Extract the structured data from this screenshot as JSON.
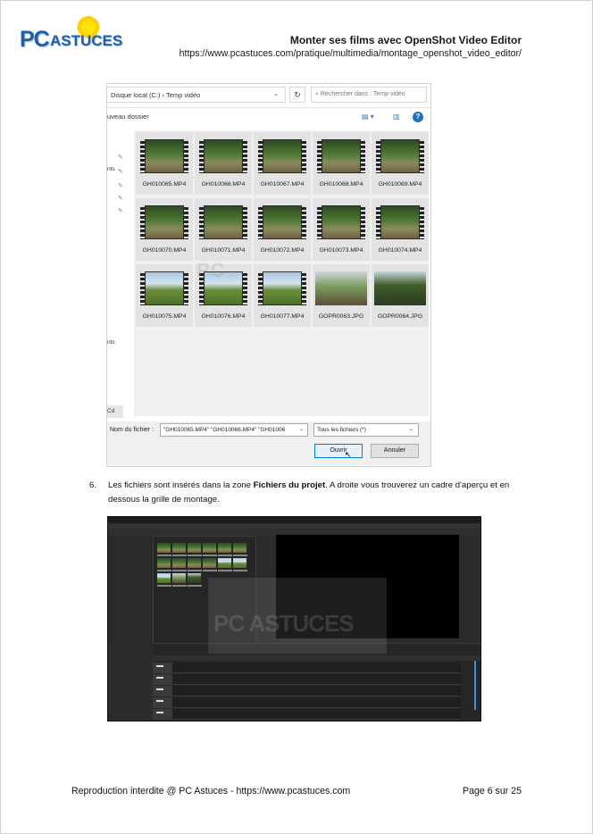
{
  "header": {
    "title": "Monter ses films avec OpenShot Video Editor",
    "url": "https://www.pcastuces.com/pratique/multimedia/montage_openshot_video_editor/"
  },
  "file_dialog": {
    "address_path": "Disque local (C:) › Temp vidéo",
    "search_placeholder": "Rechercher dans : Temp vidéo",
    "new_folder_label": "uveau dossier",
    "nav_partial_1": "nts",
    "nav_partial_2": "nts",
    "nav_partial_3": "Cd",
    "files": [
      {
        "name": "GH010065.MP4",
        "kind": "video",
        "scene": "forest"
      },
      {
        "name": "GH010066.MP4",
        "kind": "video",
        "scene": "forest"
      },
      {
        "name": "GH010067.MP4",
        "kind": "video",
        "scene": "forest"
      },
      {
        "name": "GH010068.MP4",
        "kind": "video",
        "scene": "forest"
      },
      {
        "name": "GH010069.MP4",
        "kind": "video",
        "scene": "forest"
      },
      {
        "name": "GH010070.MP4",
        "kind": "video",
        "scene": "forest"
      },
      {
        "name": "GH010071.MP4",
        "kind": "video",
        "scene": "forest"
      },
      {
        "name": "GH010072.MP4",
        "kind": "video",
        "scene": "forest"
      },
      {
        "name": "GH010073.MP4",
        "kind": "video",
        "scene": "forest"
      },
      {
        "name": "GH010074.MP4",
        "kind": "video",
        "scene": "forest"
      },
      {
        "name": "GH010075.MP4",
        "kind": "video",
        "scene": "field"
      },
      {
        "name": "GH010076.MP4",
        "kind": "video",
        "scene": "field"
      },
      {
        "name": "GH010077.MP4",
        "kind": "video",
        "scene": "field"
      },
      {
        "name": "GOPR0063.JPG",
        "kind": "photo",
        "scene": "photo"
      },
      {
        "name": "GOPR0064.JPG",
        "kind": "photo",
        "scene": "photo2"
      }
    ],
    "filename_label": "Nom du fichier :",
    "filename_value": "\"GH010065.MP4\" \"GH010066.MP4\" \"GH01006",
    "filetype_value": "Tous les fichiers  (*)",
    "open_button": "Ouvrir",
    "cancel_button": "Annuler"
  },
  "step": {
    "number": "6.",
    "text_before": "Les fichiers sont insérés dans la zone ",
    "text_bold": "Fichiers du projet",
    "text_after": ". A droite vous trouverez un cadre d'aperçu et en dessous la grille de montage."
  },
  "watermark": {
    "pc": "PC",
    "astuces": "ASTUCES"
  },
  "footer": {
    "left": "Reproduction interdite @ PC Astuces - https://www.pcastuces.com",
    "right": "Page 6 sur 25"
  },
  "colors": {
    "brand_blue": "#1f5fa8",
    "accent_blue": "#0078d7"
  }
}
